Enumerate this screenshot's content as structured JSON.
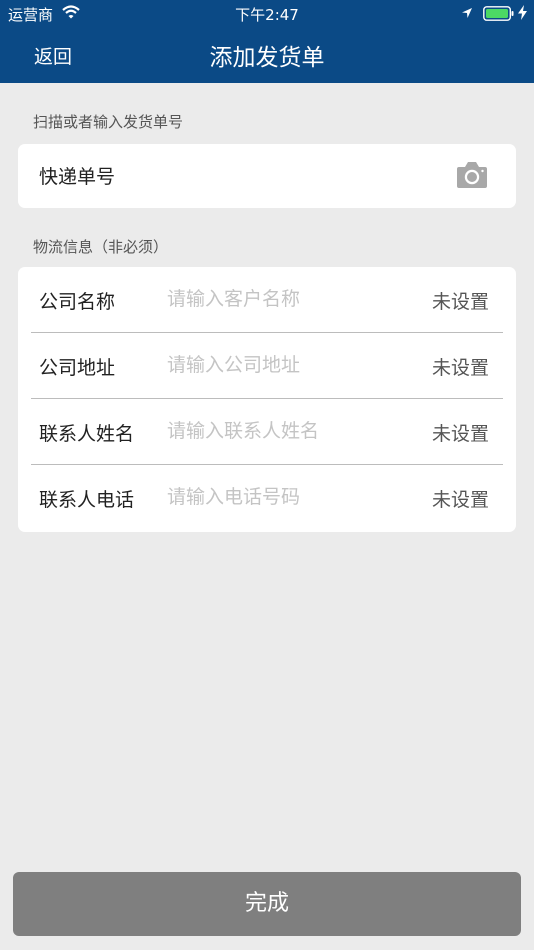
{
  "status_bar": {
    "carrier": "运营商",
    "time": "下午2:47"
  },
  "nav": {
    "back_label": "返回",
    "title": "添加发货单"
  },
  "scan_section": {
    "label": "扫描或者输入发货单号",
    "tracking_label": "快递单号"
  },
  "info_section": {
    "label": "物流信息（非必须）",
    "rows": [
      {
        "label": "公司名称",
        "placeholder": "请输入客户名称",
        "value": "",
        "status": "未设置"
      },
      {
        "label": "公司地址",
        "placeholder": "请输入公司地址",
        "value": "",
        "status": "未设置"
      },
      {
        "label": "联系人姓名",
        "placeholder": "请输入联系人姓名",
        "value": "",
        "status": "未设置"
      },
      {
        "label": "联系人电话",
        "placeholder": "请输入电话号码",
        "value": "",
        "status": "未设置"
      }
    ]
  },
  "footer": {
    "done_label": "完成"
  },
  "colors": {
    "nav_bg": "#0b4a86",
    "page_bg": "#ebebeb",
    "done_bg": "#7f7f7f",
    "battery": "#4cd964"
  }
}
